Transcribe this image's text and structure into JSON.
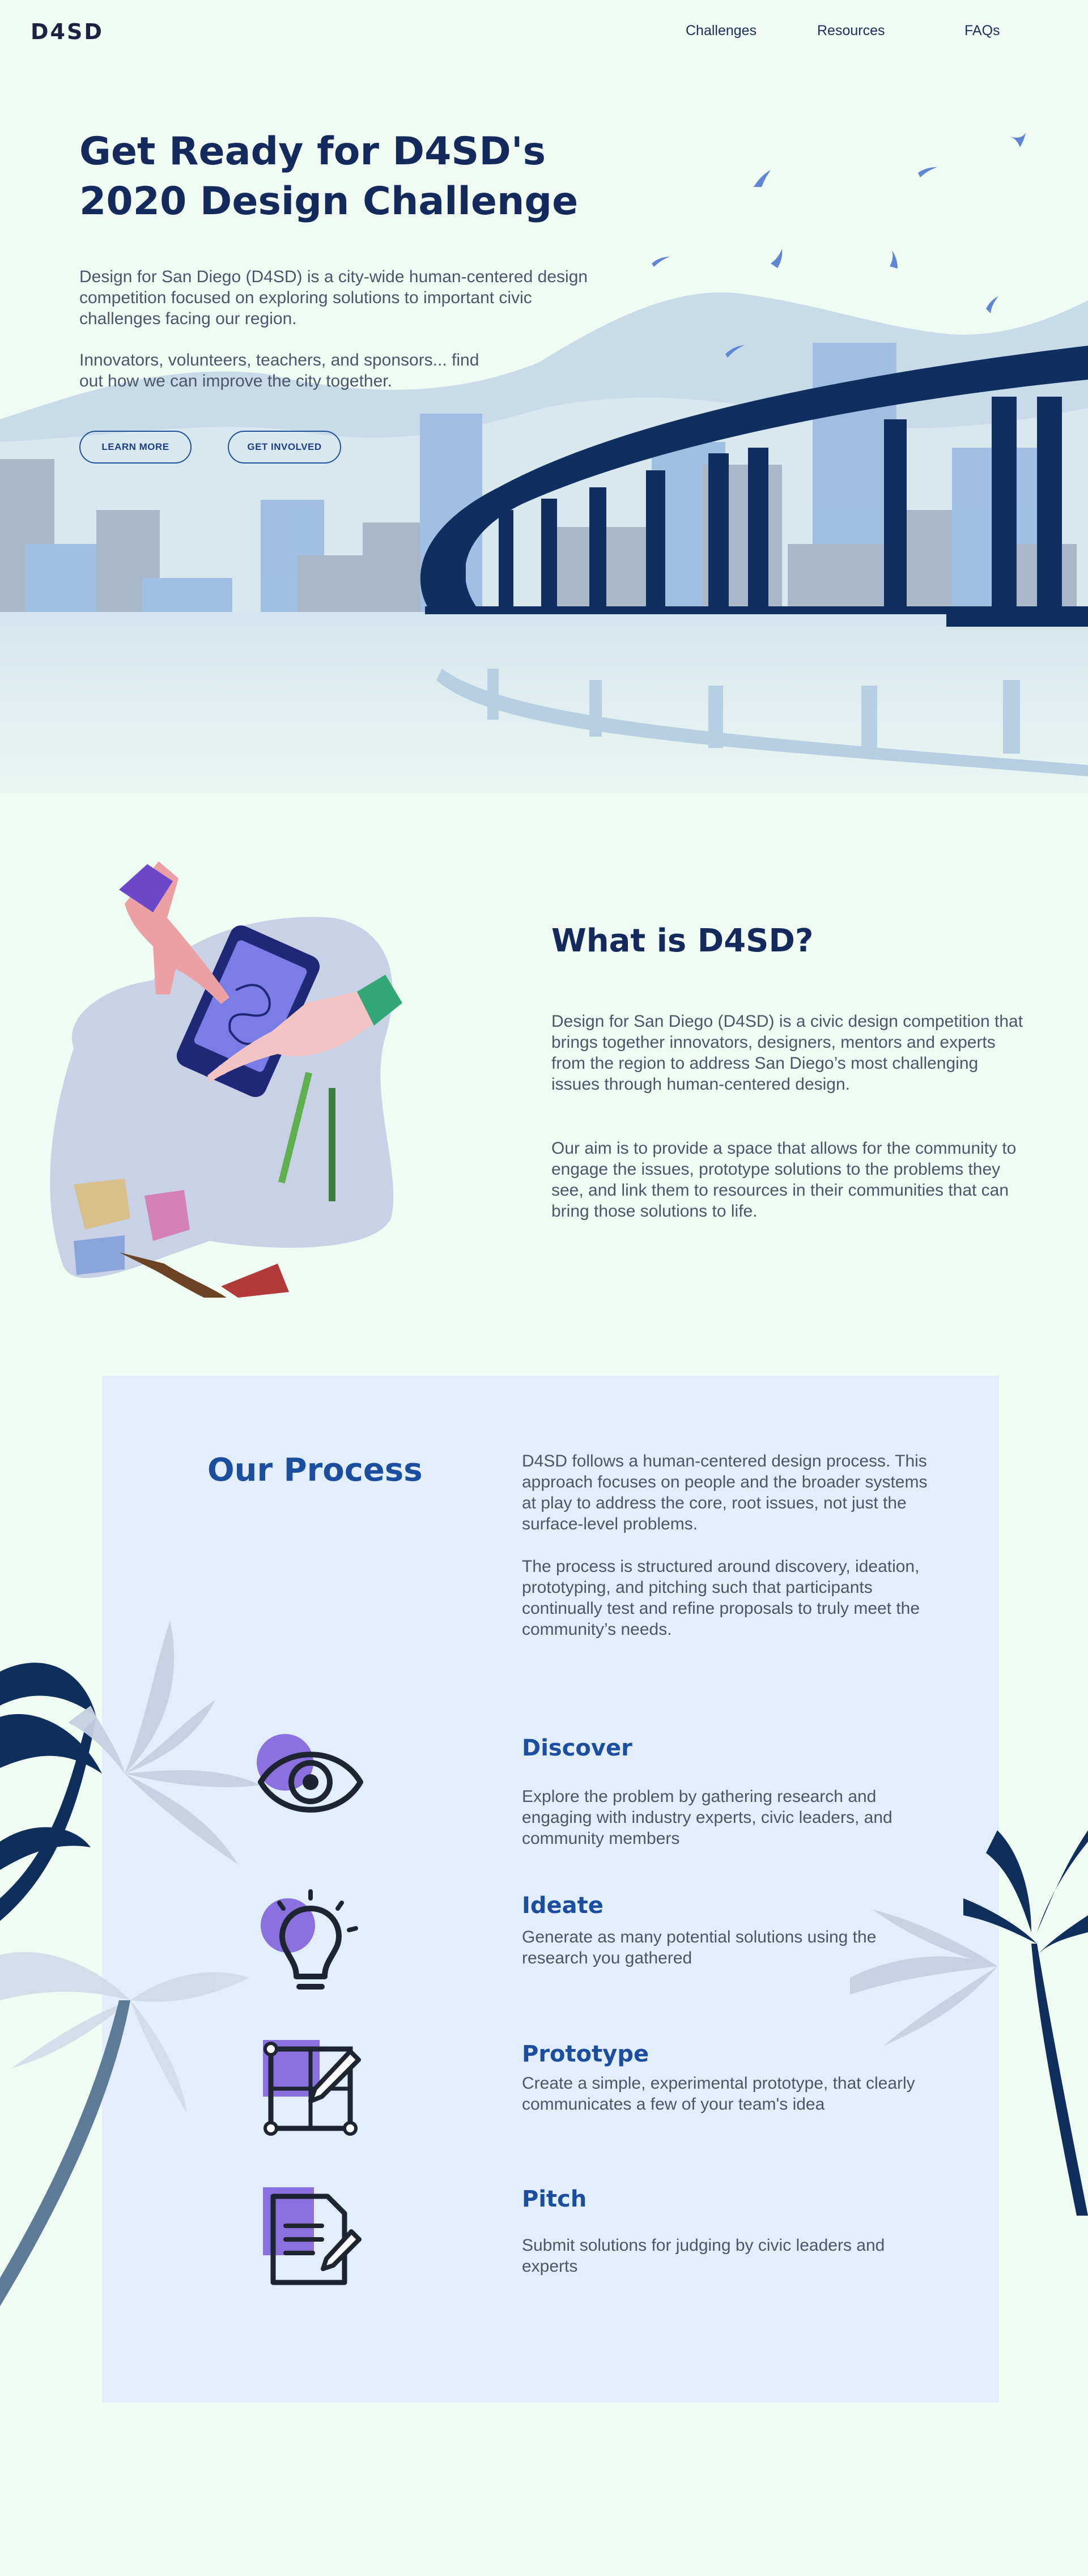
{
  "nav": {
    "logo": "D4SD",
    "links": [
      "Challenges",
      "Resources",
      "FAQs"
    ]
  },
  "hero": {
    "title_line1": "Get Ready for D4SD's",
    "title_line2": "2020 Design Challenge",
    "p1": "Design for San Diego (D4SD) is a city-wide human-centered design competition focused on exploring solutions to important civic challenges facing our region.",
    "p2": "Innovators, volunteers, teachers, and sponsors... find out how we can improve the city together.",
    "learn_more": "LEARN MORE",
    "get_involved": "GET INVOLVED"
  },
  "what": {
    "title": "What is D4SD?",
    "p1": "Design for San Diego (D4SD) is a civic design competition that brings together innovators, designers, mentors and experts from the region to address San Diego’s most challenging issues through human-centered design.",
    "p2": "Our aim is to provide a space that allows for the community to engage the issues, prototype solutions to the problems they see, and link them to resources in their communities that can bring those solutions to life."
  },
  "process": {
    "title": "Our Process",
    "p1": "D4SD follows a human-centered design process. This approach focuses on people and the broader systems at play to address the core, root issues, not just the surface-level problems.",
    "p2": "The process is structured around discovery, ideation, prototyping, and pitching such that participants continually test and refine proposals to truly meet the community’s needs.",
    "steps": [
      {
        "title": "Discover",
        "desc": "Explore the problem by gathering research and engaging with industry experts, civic leaders, and community members",
        "icon": "eye-icon"
      },
      {
        "title": "Ideate",
        "desc": "Generate as many potential solutions using the research you gathered",
        "icon": "lightbulb-icon"
      },
      {
        "title": "Prototype",
        "desc": "Create a simple, experimental prototype, that clearly communicates a few of your team's idea",
        "icon": "prototype-pen-icon"
      },
      {
        "title": "Pitch",
        "desc": "Submit solutions for judging by civic leaders and experts",
        "icon": "document-pen-icon"
      }
    ]
  },
  "colors": {
    "background": "#effbf3",
    "navy": "#142a5c",
    "accent_blue": "#1c4ea0",
    "card": "#e2eefb"
  }
}
